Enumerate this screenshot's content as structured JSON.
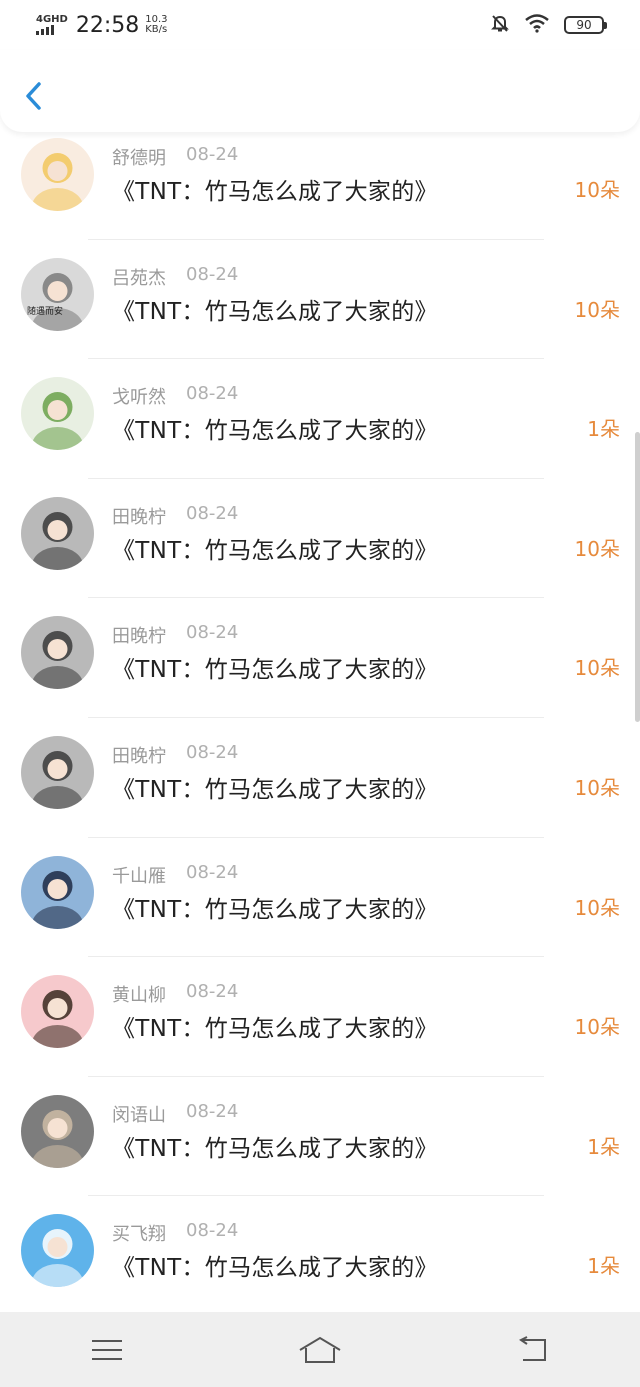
{
  "status_bar": {
    "network": "4GHD",
    "time": "22:58",
    "net_speed_value": "10.3",
    "net_speed_unit": "KB/s",
    "battery": "90",
    "icons": [
      "mute-bell-icon",
      "wifi-icon",
      "battery-icon"
    ]
  },
  "header": {
    "back_icon": "chevron-left-icon"
  },
  "colors": {
    "accent": "#2a8cd8",
    "amount": "#e68a3c",
    "meta": "#9a9a9a"
  },
  "rows": [
    {
      "name": "舒德明",
      "date": "08-24",
      "title": "《TNT：竹马怎么成了大家的》",
      "amount": "10朵",
      "avatar_color": "#f2c75a",
      "avatar_bg": "#f9ece0"
    },
    {
      "name": "吕苑杰",
      "date": "08-24",
      "title": "《TNT：竹马怎么成了大家的》",
      "amount": "10朵",
      "avatar_color": "#7a7a7a",
      "avatar_bg": "#d9d9d9",
      "avatar_text": "随遇而安"
    },
    {
      "name": "戈听然",
      "date": "08-24",
      "title": "《TNT：竹马怎么成了大家的》",
      "amount": "1朵",
      "avatar_color": "#6aa14a",
      "avatar_bg": "#e8efe2"
    },
    {
      "name": "田晚柠",
      "date": "08-24",
      "title": "《TNT：竹马怎么成了大家的》",
      "amount": "10朵",
      "avatar_color": "#3a3a3a",
      "avatar_bg": "#b9b9b9"
    },
    {
      "name": "田晚柠",
      "date": "08-24",
      "title": "《TNT：竹马怎么成了大家的》",
      "amount": "10朵",
      "avatar_color": "#3a3a3a",
      "avatar_bg": "#b9b9b9"
    },
    {
      "name": "田晚柠",
      "date": "08-24",
      "title": "《TNT：竹马怎么成了大家的》",
      "amount": "10朵",
      "avatar_color": "#3a3a3a",
      "avatar_bg": "#b9b9b9"
    },
    {
      "name": "千山雁",
      "date": "08-24",
      "title": "《TNT：竹马怎么成了大家的》",
      "amount": "10朵",
      "avatar_color": "#1f2a44",
      "avatar_bg": "#8fb4d9"
    },
    {
      "name": "黄山柳",
      "date": "08-24",
      "title": "《TNT：竹马怎么成了大家的》",
      "amount": "10朵",
      "avatar_color": "#3a2a20",
      "avatar_bg": "#f6c9cc"
    },
    {
      "name": "闵语山",
      "date": "08-24",
      "title": "《TNT：竹马怎么成了大家的》",
      "amount": "1朵",
      "avatar_color": "#cdbba4",
      "avatar_bg": "#7d7d7d"
    },
    {
      "name": "买飞翔",
      "date": "08-24",
      "title": "《TNT：竹马怎么成了大家的》",
      "amount": "1朵",
      "avatar_color": "#ffffff",
      "avatar_bg": "#5fb3ea"
    }
  ],
  "navbar": {
    "icons": [
      "menu-icon",
      "home-icon",
      "back-icon"
    ]
  }
}
